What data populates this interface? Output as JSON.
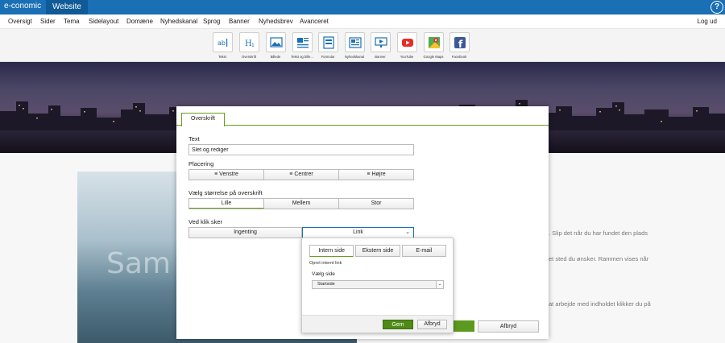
{
  "header": {
    "brand": "e-conomic",
    "tab": "Website",
    "help_symbol": "?",
    "accent_color": "#1a6fb5"
  },
  "nav": {
    "items": [
      "Oversigt",
      "Sider",
      "Tema",
      "Sidelayout",
      "Domæne",
      "Nyhedskanal",
      "Sprog",
      "Banner",
      "Nyhedsbrev",
      "Avanceret"
    ],
    "logout": "Log ud"
  },
  "toolbar": {
    "tools": [
      {
        "label": "Tekst",
        "icon": "text-icon"
      },
      {
        "label": "Overskrift",
        "icon": "heading-icon"
      },
      {
        "label": "Billede",
        "icon": "image-icon"
      },
      {
        "label": "Tekst og bille...",
        "icon": "text-image-icon"
      },
      {
        "label": "Formular",
        "icon": "form-icon"
      },
      {
        "label": "Nyhedskanal",
        "icon": "newsfeed-icon"
      },
      {
        "label": "Banner",
        "icon": "banner-icon"
      },
      {
        "label": "YouTube",
        "icon": "youtube-icon"
      },
      {
        "label": "Google Maps",
        "icon": "google-maps-icon"
      },
      {
        "label": "Facebook",
        "icon": "facebook-icon"
      }
    ]
  },
  "background": {
    "photo_text": "Sam",
    "lines": [
      ". Slip det når du har fundet den plads",
      "et sted du ønsker. Rammen vises når",
      "at arbejde med indholdet klikker du på"
    ]
  },
  "modal": {
    "tab": "Overskrift",
    "text_label": "Text",
    "text_value": "Slet og rediger",
    "placement_label": "Placering",
    "placement_options": [
      "Venstre",
      "Centrer",
      "Højre"
    ],
    "size_label": "Vælg størrelse på overskrift",
    "size_options": [
      "Lille",
      "Mellem",
      "Stor"
    ],
    "size_selected": "Lille",
    "click_label": "Ved klik sker",
    "click_options": [
      "Ingenting",
      "Link"
    ],
    "cancel": "Afbryd"
  },
  "popup": {
    "tabs": [
      "Intern side",
      "Ekstern side",
      "E-mail"
    ],
    "active_tab": "Intern side",
    "subtitle": "Opret internt link",
    "select_label": "Vælg side",
    "select_value": "Startside",
    "save": "Gem",
    "cancel": "Afbryd",
    "save_color": "#4f8a16"
  }
}
